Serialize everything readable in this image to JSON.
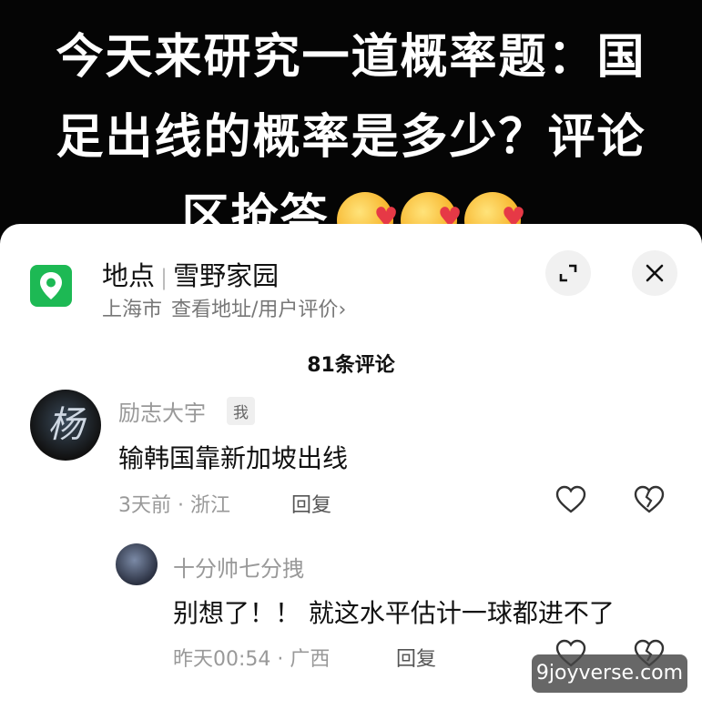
{
  "video_caption": {
    "line1": "今天来研究一道概率题：国",
    "line2": "足出线的概率是多少？评论",
    "line3": "区抢答"
  },
  "location_panel": {
    "label": "地点",
    "name": "雪野家园",
    "city": "上海市",
    "link_text": "查看地址/用户评价",
    "link_arrow": "›",
    "accent_color": "#1db954"
  },
  "comments_header": {
    "count_text": "81条评论"
  },
  "comments": [
    {
      "author": "励志大宇",
      "author_badge": "我",
      "avatar_glyph": "杨",
      "text": "输韩国靠新加坡出线",
      "meta": "3天前 · 浙江",
      "reply_label": "回复"
    },
    {
      "author": "十分帅七分拽",
      "text": "别想了！！ 就这水平估计一球都进不了",
      "meta": "昨天00:54 · 广西",
      "reply_label": "回复"
    }
  ],
  "watermark": "9joyverse.com",
  "icons": [
    "location-icon",
    "expand-icon",
    "close-icon",
    "like-icon",
    "dislike-icon",
    "love-emoji"
  ]
}
